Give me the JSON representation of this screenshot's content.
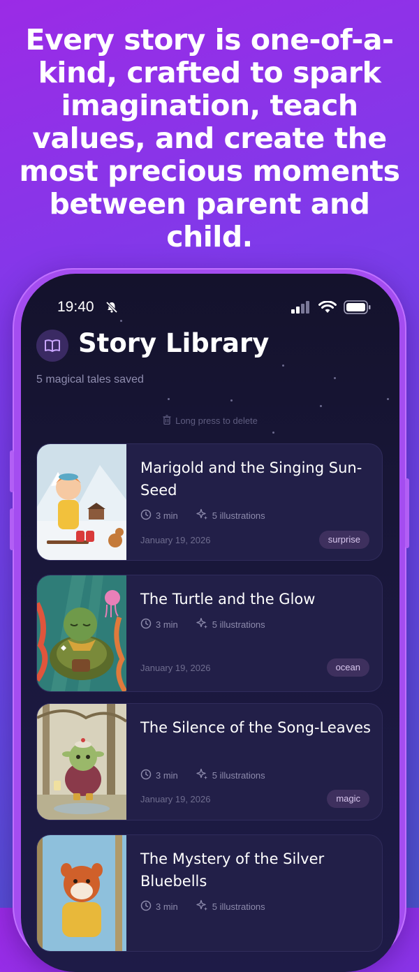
{
  "headline": "Every story is one-of-a-kind, crafted to spark imagination, teach values, and create the most precious moments between parent and child.",
  "status_bar": {
    "time": "19:40"
  },
  "header": {
    "title": "Story Library",
    "subtitle": "5 magical tales saved",
    "hint": "Long press to delete"
  },
  "stories": [
    {
      "title": "Marigold and the Singing Sun-Seed",
      "duration": "3 min",
      "illustrations": "5 illustrations",
      "date": "January 19, 2026",
      "tag": "surprise"
    },
    {
      "title": "The Turtle and the Glow",
      "duration": "3 min",
      "illustrations": "5 illustrations",
      "date": "January 19, 2026",
      "tag": "ocean"
    },
    {
      "title": "The Silence of the Song-Leaves",
      "duration": "3 min",
      "illustrations": "5 illustrations",
      "date": "January 19, 2026",
      "tag": "magic"
    },
    {
      "title": "The Mystery of the Silver Bluebells",
      "duration": "3 min",
      "illustrations": "5 illustrations",
      "date": "",
      "tag": ""
    }
  ],
  "colors": {
    "accent": "#9b2be6",
    "screen_bg": "#14122c",
    "card_bg": "#221f48",
    "tag_bg": "#3e305e"
  }
}
